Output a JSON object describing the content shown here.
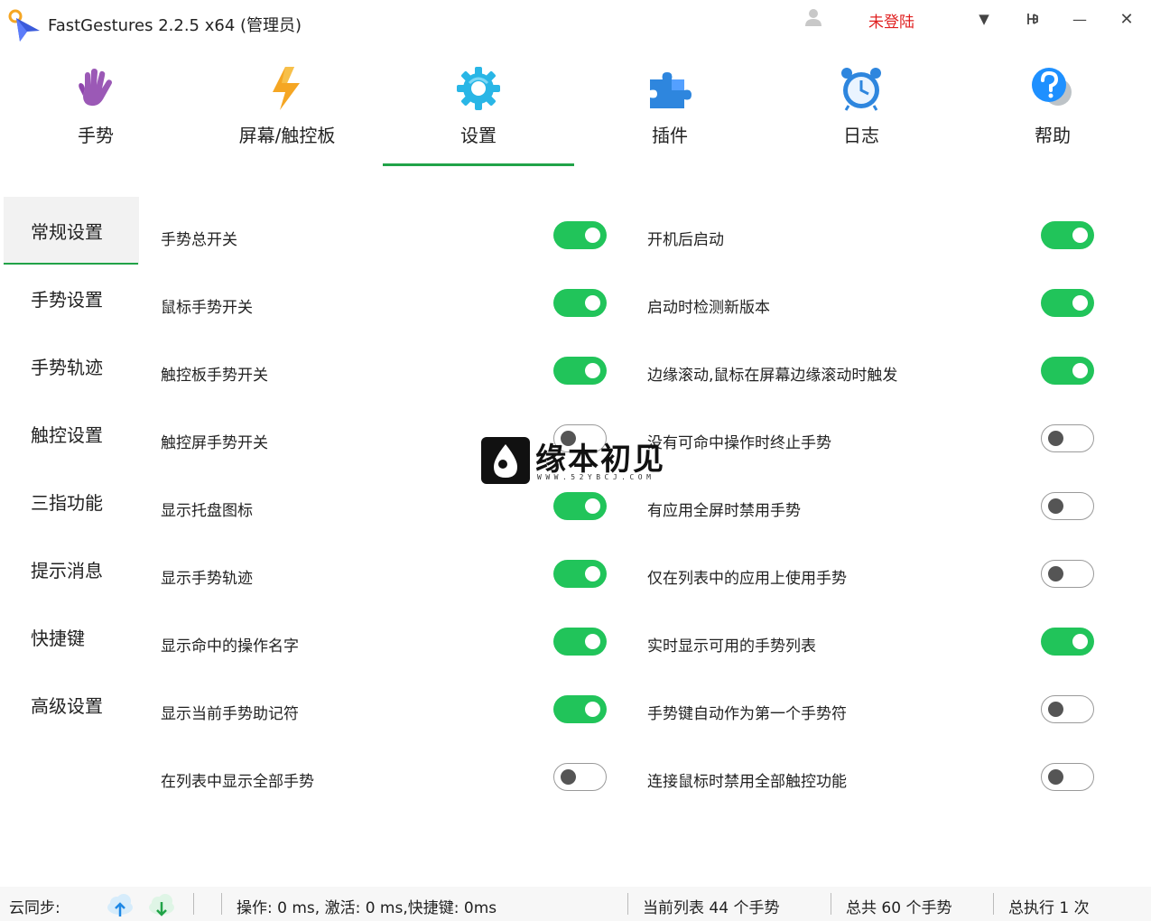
{
  "window": {
    "title": "FastGestures 2.2.5 x64  (管理员)",
    "login_status": "未登陆",
    "dropdown_glyph": "▼",
    "minimize_glyph": "—",
    "close_glyph": "✕"
  },
  "tabs": [
    {
      "label": "手势",
      "icon": "hand-icon"
    },
    {
      "label": "屏幕/触控板",
      "icon": "lightning-icon"
    },
    {
      "label": "设置",
      "icon": "gear-icon",
      "active": true
    },
    {
      "label": "插件",
      "icon": "puzzle-icon"
    },
    {
      "label": "日志",
      "icon": "alarm-clock-icon"
    },
    {
      "label": "帮助",
      "icon": "help-icon"
    }
  ],
  "sidenav": [
    {
      "label": "常规设置",
      "active": true
    },
    {
      "label": "手势设置"
    },
    {
      "label": "手势轨迹"
    },
    {
      "label": "触控设置"
    },
    {
      "label": "三指功能"
    },
    {
      "label": "提示消息"
    },
    {
      "label": "快捷键"
    },
    {
      "label": "高级设置"
    }
  ],
  "settings_left": [
    {
      "label": "手势总开关",
      "on": true
    },
    {
      "label": "鼠标手势开关",
      "on": true
    },
    {
      "label": "触控板手势开关",
      "on": true
    },
    {
      "label": "触控屏手势开关",
      "on": false
    },
    {
      "label": "显示托盘图标",
      "on": true
    },
    {
      "label": "显示手势轨迹",
      "on": true
    },
    {
      "label": "显示命中的操作名字",
      "on": true
    },
    {
      "label": "显示当前手势助记符",
      "on": true
    },
    {
      "label": "在列表中显示全部手势",
      "on": false
    }
  ],
  "settings_right": [
    {
      "label": "开机后启动",
      "on": true
    },
    {
      "label": "启动时检测新版本",
      "on": true
    },
    {
      "label": "边缘滚动,鼠标在屏幕边缘滚动时触发",
      "on": true
    },
    {
      "label": "没有可命中操作时终止手势",
      "on": false
    },
    {
      "label": "有应用全屏时禁用手势",
      "on": false
    },
    {
      "label": "仅在列表中的应用上使用手势",
      "on": false
    },
    {
      "label": "实时显示可用的手势列表",
      "on": true
    },
    {
      "label": "手势键自动作为第一个手势符",
      "on": false
    },
    {
      "label": "连接鼠标时禁用全部触控功能",
      "on": false
    }
  ],
  "watermark": {
    "text": "缘本初见",
    "sub": "WWW.52YBCJ.COM"
  },
  "statusbar": {
    "sync_label": "云同步:",
    "timing": "操作: 0 ms, 激活: 0 ms,快捷键: 0ms",
    "current_list": "当前列表 44 个手势",
    "total": "总共 60 个手势",
    "executed": "总执行 1 次"
  },
  "colors": {
    "accent": "#21a348",
    "toggle_on": "#21c45a",
    "login": "#e02020"
  }
}
